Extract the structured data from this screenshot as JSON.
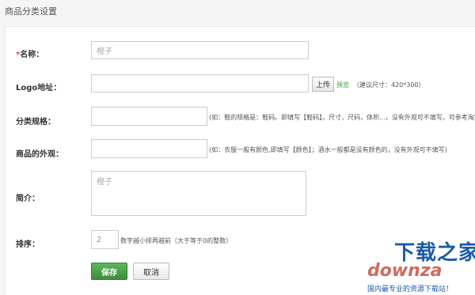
{
  "page": {
    "title": "商品分类设置"
  },
  "form": {
    "name": {
      "required_mark": "*",
      "label": "名称：",
      "value": "橙子"
    },
    "logo": {
      "label": "Logo地址：",
      "value": "",
      "upload_label": "上传",
      "preview_label": "预览",
      "hint": "（建议尺寸：420*300）"
    },
    "spec": {
      "label": "分类规格：",
      "value": "",
      "hint": "(如：鞋的规格是：鞋码。即填写【鞋码】。尺寸，尺码，体积...，没有外观可不填写。可参考淘宝"
    },
    "appearance": {
      "label": "商品的外观：",
      "value": "",
      "hint": "(如：衣服一般有颜色,即填写【颜色】；酒水一般都是没有颜色的，没有外观可不填写)"
    },
    "intro": {
      "label": "简介：",
      "value": "橙子"
    },
    "sort": {
      "label": "排序：",
      "value": "2",
      "hint": "数字越小排再越前（大于等于0的整数）"
    },
    "save_label": "保存",
    "cancel_label": "取消"
  },
  "watermark": {
    "title": "下载之家",
    "logo": "downza",
    "subtitle": "国内最专业的资源下载站！"
  },
  "colors": {
    "save_button": "#4cae4c",
    "required": "#d9534f",
    "preview_link": "#3a9a3a",
    "watermark": "#1a5aa8"
  }
}
